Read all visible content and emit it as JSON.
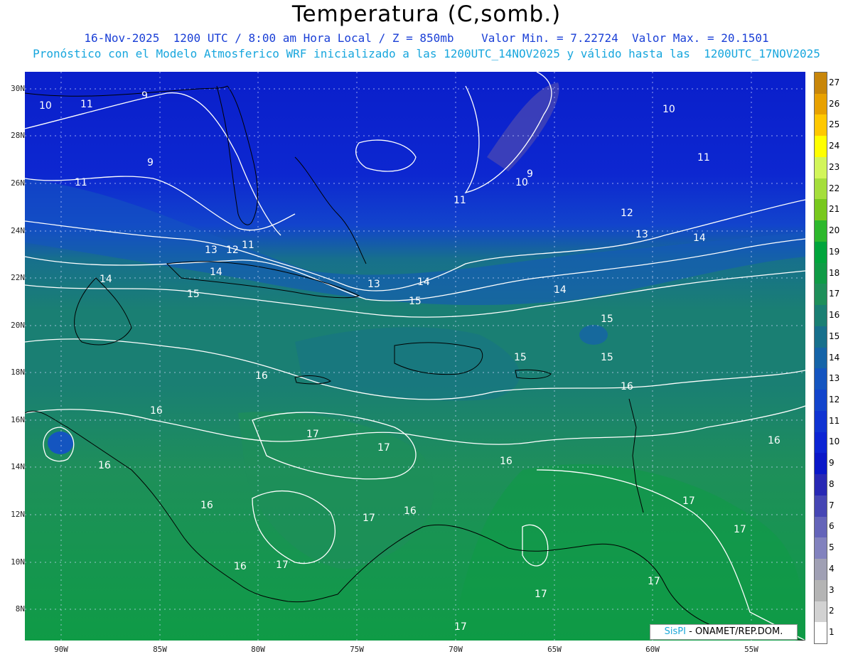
{
  "header": {
    "title": "Temperatura (C,somb.)",
    "line1": "16-Nov-2025  1200 UTC / 8:00 am Hora Local / Z = 850mb    Valor Min. = 7.22724  Valor Max. = 20.1501",
    "line2": "Pronóstico con el Modelo Atmosferico WRF inicializado a las 1200UTC_14NOV2025 y válido hasta las  1200UTC_17NOV2025"
  },
  "axes": {
    "lat_labels": [
      "30N",
      "28N",
      "26N",
      "24N",
      "22N",
      "20N",
      "18N",
      "16N",
      "14N",
      "12N",
      "10N",
      "8N"
    ],
    "lon_labels": [
      "90W",
      "85W",
      "80W",
      "75W",
      "70W",
      "65W",
      "60W",
      "55W"
    ]
  },
  "colorbar": {
    "labels": [
      "27",
      "26",
      "25",
      "24",
      "23",
      "22",
      "21",
      "20",
      "19",
      "18",
      "17",
      "16",
      "15",
      "14",
      "13",
      "12",
      "11",
      "10",
      "9",
      "8",
      "7",
      "6",
      "5",
      "4",
      "3",
      "2",
      "1"
    ],
    "colors": [
      "#c8860a",
      "#e8a100",
      "#ffc800",
      "#ffff00",
      "#d2f55a",
      "#a5de3c",
      "#78c81e",
      "#2db82d",
      "#00a53c",
      "#0f9b46",
      "#1e8f5a",
      "#1a7f73",
      "#17708c",
      "#1564a8",
      "#1455c0",
      "#1244cc",
      "#0f33d2",
      "#0c24d4",
      "#0a17c8",
      "#2828b4",
      "#4646b4",
      "#6464b9",
      "#8282be",
      "#a0a0b4",
      "#b4b4b4",
      "#d2d2d2",
      "#ffffff"
    ]
  },
  "contour_labels": [
    "9",
    "10",
    "11",
    "12",
    "13",
    "14",
    "15",
    "16",
    "17"
  ],
  "credit": {
    "brand": "SisPI",
    "org": " - ONAMET/REP.DOM."
  },
  "colors": {
    "title": "#000000",
    "subtitle1": "#1a3fd6",
    "subtitle2": "#17a6dd",
    "land_line": "#000000",
    "contour": "#ffffff"
  }
}
